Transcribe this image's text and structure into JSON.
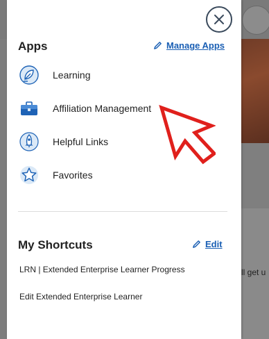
{
  "apps_panel": {
    "title": "Apps",
    "manage_label": "Manage Apps",
    "items": [
      {
        "label": "Learning",
        "icon": "learning-icon"
      },
      {
        "label": "Affiliation Management",
        "icon": "briefcase-icon"
      },
      {
        "label": "Helpful Links",
        "icon": "rocket-icon"
      },
      {
        "label": "Favorites",
        "icon": "star-icon"
      }
    ]
  },
  "shortcuts": {
    "title": "My Shortcuts",
    "edit_label": "Edit",
    "items": [
      "LRN | Extended Enterprise Learner Progress",
      "Edit Extended Enterprise Learner"
    ]
  },
  "background": {
    "partial_text": "ll get u"
  },
  "colors": {
    "link": "#1a5fb4",
    "annotation_arrow": "#e0201c",
    "icon_fill": "#dbe9f7",
    "icon_stroke": "#1e63b6"
  }
}
